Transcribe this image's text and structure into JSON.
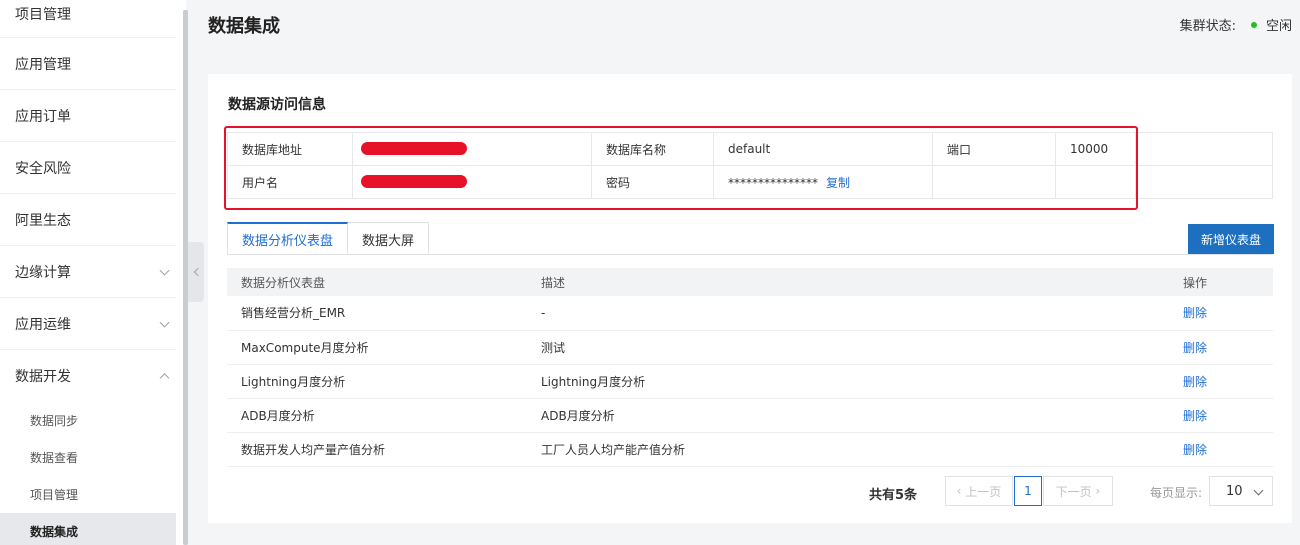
{
  "sidebar": {
    "items": [
      {
        "label": "项目管理"
      },
      {
        "label": "应用管理"
      },
      {
        "label": "应用订单"
      },
      {
        "label": "安全风险"
      },
      {
        "label": "阿里生态"
      },
      {
        "label": "边缘计算"
      },
      {
        "label": "应用运维"
      },
      {
        "label": "数据开发"
      }
    ],
    "sub_items": [
      {
        "label": "数据同步"
      },
      {
        "label": "数据查看"
      },
      {
        "label": "项目管理"
      },
      {
        "label": "数据集成"
      }
    ]
  },
  "header": {
    "title": "数据集成",
    "cluster_label": "集群状态:",
    "cluster_status": "空闲"
  },
  "datasource": {
    "title": "数据源访问信息",
    "db_address_label": "数据库地址",
    "db_name_label": "数据库名称",
    "db_name_value": "default",
    "port_label": "端口",
    "port_value": "10000",
    "username_label": "用户名",
    "password_label": "密码",
    "password_value": "***************",
    "copy_label": "复制"
  },
  "tabs": [
    {
      "label": "数据分析仪表盘"
    },
    {
      "label": "数据大屏"
    }
  ],
  "add_button": "新增仪表盘",
  "table": {
    "headers": [
      "数据分析仪表盘",
      "描述",
      "操作"
    ],
    "rows": [
      {
        "name": "销售经营分析_EMR",
        "desc": "-",
        "action": "删除"
      },
      {
        "name": "MaxCompute月度分析",
        "desc": "测试",
        "action": "删除"
      },
      {
        "name": "Lightning月度分析",
        "desc": "Lightning月度分析",
        "action": "删除"
      },
      {
        "name": "ADB月度分析",
        "desc": "ADB月度分析",
        "action": "删除"
      },
      {
        "name": "数据开发人均产量产值分析",
        "desc": "工厂人员人均产能产值分析",
        "action": "删除"
      }
    ]
  },
  "pagination": {
    "total": "共有5条",
    "prev": "上一页",
    "current": "1",
    "next": "下一页",
    "per_page_label": "每页显示:",
    "per_page_value": "10"
  },
  "colors": {
    "accent": "#1f6ed4",
    "primary_button": "#1d6fbf",
    "status_idle": "#1dc11d",
    "highlight": "#e8112a"
  }
}
